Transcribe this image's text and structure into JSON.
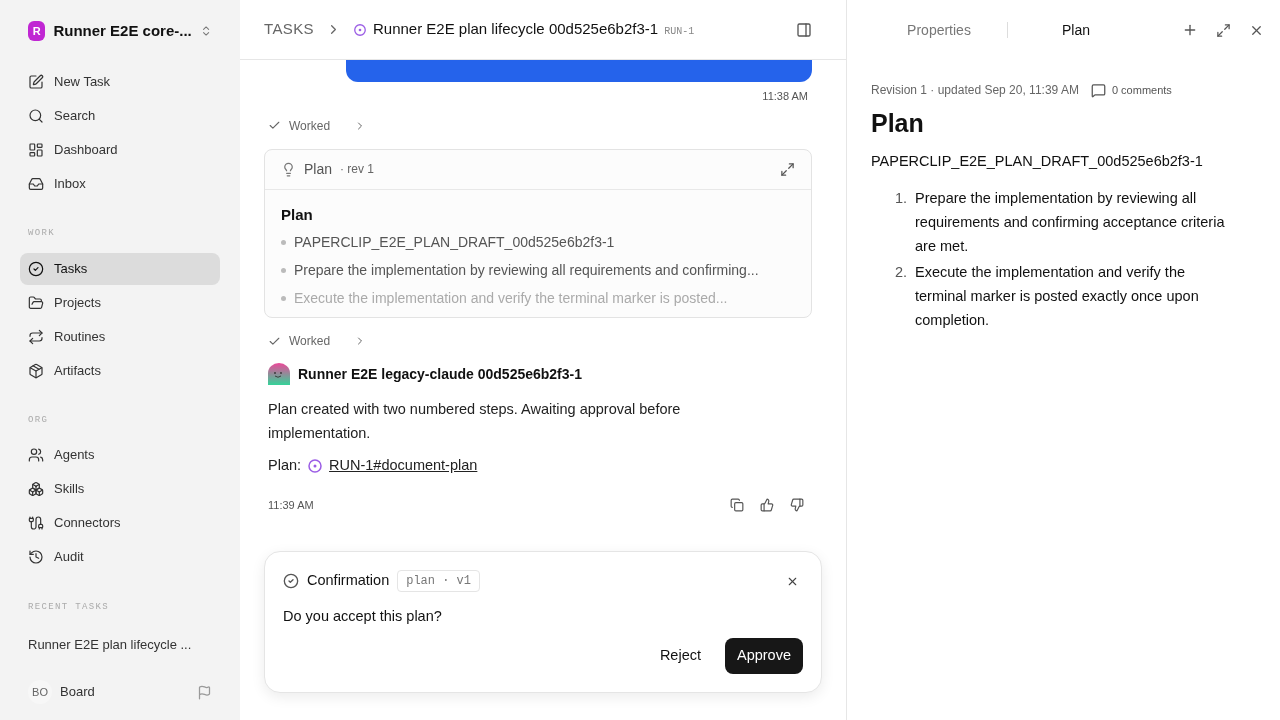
{
  "sidebar": {
    "workspace": {
      "initial": "R",
      "name": "Runner E2E core-..."
    },
    "top_items": [
      {
        "label": "New Task",
        "selected": false
      },
      {
        "label": "Search",
        "selected": false
      },
      {
        "label": "Dashboard",
        "selected": false
      },
      {
        "label": "Inbox",
        "selected": false
      }
    ],
    "sections": [
      {
        "heading": "WORK",
        "items": [
          {
            "label": "Tasks",
            "selected": true
          },
          {
            "label": "Projects",
            "selected": false
          },
          {
            "label": "Routines",
            "selected": false
          },
          {
            "label": "Artifacts",
            "selected": false
          }
        ]
      },
      {
        "heading": "ORG",
        "items": [
          {
            "label": "Agents",
            "selected": false
          },
          {
            "label": "Skills",
            "selected": false
          },
          {
            "label": "Connectors",
            "selected": false
          },
          {
            "label": "Audit",
            "selected": false
          }
        ]
      }
    ],
    "recent": {
      "heading": "RECENT TASKS",
      "items": [
        "Runner E2E plan lifecycle ..."
      ]
    },
    "user": {
      "initials": "BO",
      "name": "Board"
    }
  },
  "header": {
    "breadcrumb": "TASKS",
    "title": "Runner E2E plan lifecycle 00d525e6b2f3-1",
    "id": "RUN-1"
  },
  "thread": {
    "message_time": "11:38 AM",
    "worked_1": "Worked",
    "plan_card": {
      "title": "Plan",
      "revision": "· rev 1",
      "heading": "Plan",
      "bullets": [
        "PAPERCLIP_E2E_PLAN_DRAFT_00d525e6b2f3-1",
        "Prepare the implementation by reviewing all requirements and confirming...",
        "Execute the implementation and verify the terminal marker is posted..."
      ]
    },
    "worked_2": "Worked",
    "agent": {
      "name": "Runner E2E legacy-claude 00d525e6b2f3-1",
      "text": "Plan created with two numbered steps. Awaiting approval before implementation.",
      "link_label": "Plan:",
      "link": "RUN-1#document-plan",
      "time": "11:39 AM"
    }
  },
  "confirmation": {
    "title": "Confirmation",
    "tag": "plan · v1",
    "question": "Do you accept this plan?",
    "reject": "Reject",
    "approve": "Approve"
  },
  "panel": {
    "tabs": [
      {
        "label": "Properties",
        "selected": false
      },
      {
        "label": "Plan",
        "selected": true
      }
    ],
    "meta": "Revision 1 · updated Sep 20, 11:39 AM",
    "comments": "0 comments",
    "title": "Plan",
    "code": "PAPERCLIP_E2E_PLAN_DRAFT_00d525e6b2f3-1",
    "steps": [
      {
        "number": "1.",
        "text": "Prepare the implementation by reviewing all requirements and confirming acceptance criteria are met."
      },
      {
        "number": "2.",
        "text": "Execute the implementation and verify the terminal marker is posted exactly once upon completion."
      }
    ]
  }
}
